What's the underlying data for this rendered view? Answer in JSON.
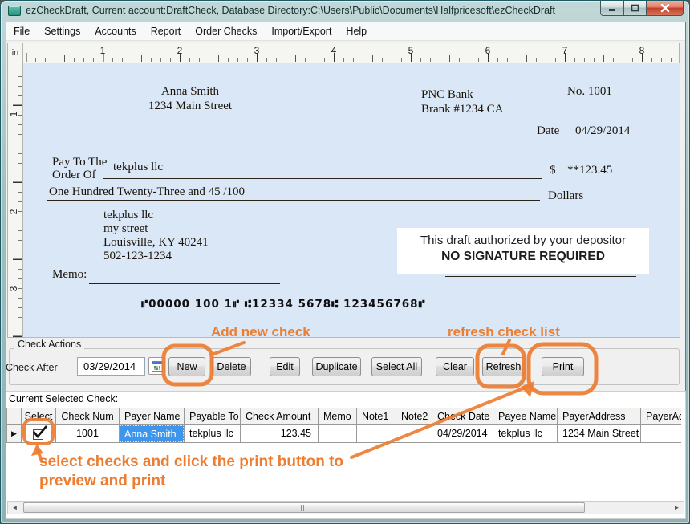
{
  "window": {
    "title": "ezCheckDraft, Current account:DraftCheck, Database Directory:C:\\Users\\Public\\Documents\\Halfpricesoft\\ezCheckDraft"
  },
  "menu": {
    "items": [
      "File",
      "Settings",
      "Accounts",
      "Report",
      "Order Checks",
      "Import/Export",
      "Help"
    ]
  },
  "ruler": {
    "unit": "in",
    "h": [
      "1",
      "2",
      "3",
      "4",
      "5",
      "6",
      "7",
      "8"
    ],
    "v": [
      "1",
      "2",
      "3"
    ]
  },
  "check": {
    "payer_name": "Anna Smith",
    "payer_street": "1234 Main Street",
    "bank_name": "PNC Bank",
    "bank_branch": "Brank #1234 CA",
    "check_no": "No. 1001",
    "date_label": "Date",
    "date_value": "04/29/2014",
    "pay_to_line1": "Pay To The",
    "pay_to_line2": "Order Of",
    "payee": "tekplus llc",
    "amount_words": "One Hundred  Twenty-Three  and 45 /100",
    "dollar_sign": "$",
    "amount_numeric": "**123.45",
    "dollars_label": "Dollars",
    "payee_addr1": "tekplus llc",
    "payee_addr2": "my street",
    "payee_addr3": "Louisville, KY 40241",
    "payee_addr4": "502-123-1234",
    "memo_label": "Memo:",
    "auth_line1": "This draft authorized by your depositor",
    "auth_line2": "NO SIGNATURE REQUIRED",
    "micr": "⑈00000 100 1⑈ ⑆12334 5678⑆ 123456768⑈"
  },
  "actions": {
    "group_title": "Check Actions",
    "check_after_label": "Check After",
    "check_after_value": "03/29/2014",
    "buttons": [
      "New",
      "Delete",
      "Edit",
      "Duplicate",
      "Select All",
      "Clear",
      "Refresh",
      "Print"
    ]
  },
  "grid": {
    "label": "Current Selected Check:",
    "columns": [
      "Select",
      "Check Num",
      "Payer Name",
      "Payable To",
      "Check Amount",
      "Memo",
      "Note1",
      "Note2",
      "Check Date",
      "Payee Name",
      "PayerAddress",
      "PayerAdd"
    ],
    "row": {
      "check_num": "1001",
      "payer_name": "Anna Smith",
      "payable_to": "tekplus llc",
      "check_amount": "123.45",
      "memo": "",
      "note1": "",
      "note2": "",
      "check_date": "04/29/2014",
      "payee_name": "tekplus llc",
      "payer_address": "1234 Main Street",
      "payer_add2": ""
    }
  },
  "annotations": {
    "accent_color": "#ED7D31",
    "add_new": "Add new check",
    "refresh": "refresh check list",
    "select_line1": "select checks and click the print button to",
    "select_line2": "preview and print"
  },
  "icons": {
    "row_selector": "▶",
    "scroll_left": "◄",
    "scroll_right": "►"
  }
}
